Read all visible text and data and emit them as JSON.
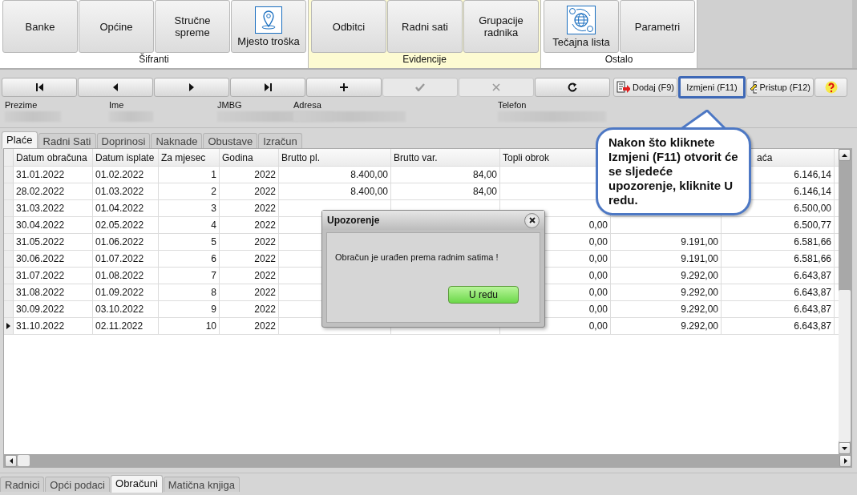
{
  "ribbon": {
    "groups": [
      {
        "label": "Šifranti",
        "highlighted": false,
        "buttons": [
          {
            "label": "Banke"
          },
          {
            "label": "Općine"
          },
          {
            "label": "Stručne spreme"
          },
          {
            "label": "Mjesto troška",
            "kind": "location"
          }
        ]
      },
      {
        "label": "Evidencije",
        "highlighted": true,
        "buttons": [
          {
            "label": "Odbitci"
          },
          {
            "label": "Radni sati"
          },
          {
            "label": "Grupacije radnika"
          }
        ]
      },
      {
        "label": "Ostalo",
        "highlighted": false,
        "buttons": [
          {
            "label": "Tečajna lista",
            "kind": "currency"
          },
          {
            "label": "Parametri"
          }
        ]
      }
    ]
  },
  "navigator": [
    {
      "kind": "first",
      "disabled": false
    },
    {
      "kind": "prev",
      "disabled": false
    },
    {
      "kind": "next",
      "disabled": false
    },
    {
      "kind": "last",
      "disabled": false
    },
    {
      "kind": "add",
      "disabled": false
    },
    {
      "kind": "confirm",
      "disabled": true
    },
    {
      "kind": "cancel",
      "disabled": true
    },
    {
      "kind": "refresh",
      "disabled": false
    }
  ],
  "actions": [
    {
      "label": "Dodaj (F9)",
      "kind": "add",
      "highlighted": false
    },
    {
      "label": "Izmjeni (F11)",
      "kind": "edit",
      "highlighted": true
    },
    {
      "label": "Pristup (F12)",
      "kind": "access",
      "highlighted": false
    },
    {
      "kind": "help",
      "highlighted": false
    }
  ],
  "fields": [
    {
      "label": "Prezime"
    },
    {
      "label": "Ime"
    },
    {
      "label": "JMBG"
    },
    {
      "label": "Adresa"
    },
    {
      "label": "Telefon"
    }
  ],
  "tabs": [
    {
      "label": "Plaće",
      "selected": true
    },
    {
      "label": "Radni Sati",
      "selected": false
    },
    {
      "label": "Doprinosi",
      "selected": false
    },
    {
      "label": "Naknade",
      "selected": false
    },
    {
      "label": "Obustave",
      "selected": false
    },
    {
      "label": "Izračun",
      "selected": false
    }
  ],
  "table": {
    "columns": [
      "Datum obračuna",
      "Datum isplate",
      "Za mjesec",
      "Godina",
      "Brutto pl.",
      "Brutto var.",
      "Topli obrok",
      null,
      "aća"
    ],
    "rows": [
      {
        "selected": false,
        "cells": [
          "31.01.2022",
          "01.02.2022",
          "1",
          "2022",
          "8.400,00",
          "84,00",
          null,
          null,
          "6.146,14"
        ]
      },
      {
        "selected": false,
        "cells": [
          "28.02.2022",
          "01.03.2022",
          "2",
          "2022",
          "8.400,00",
          "84,00",
          null,
          null,
          "6.146,14"
        ]
      },
      {
        "selected": false,
        "cells": [
          "31.03.2022",
          "01.04.2022",
          "3",
          "2022",
          null,
          null,
          null,
          null,
          "6.500,00"
        ]
      },
      {
        "selected": false,
        "cells": [
          "30.04.2022",
          "02.05.2022",
          "4",
          "2022",
          null,
          null,
          "0,00",
          null,
          "6.500,77"
        ]
      },
      {
        "selected": false,
        "cells": [
          "31.05.2022",
          "01.06.2022",
          "5",
          "2022",
          null,
          null,
          "0,00",
          "9.191,00",
          "6.581,66"
        ]
      },
      {
        "selected": false,
        "cells": [
          "30.06.2022",
          "01.07.2022",
          "6",
          "2022",
          null,
          null,
          "0,00",
          "9.191,00",
          "6.581,66"
        ]
      },
      {
        "selected": false,
        "cells": [
          "31.07.2022",
          "01.08.2022",
          "7",
          "2022",
          null,
          null,
          "0,00",
          "9.292,00",
          "6.643,87"
        ]
      },
      {
        "selected": false,
        "cells": [
          "31.08.2022",
          "01.09.2022",
          "8",
          "2022",
          null,
          null,
          "0,00",
          "9.292,00",
          "6.643,87"
        ]
      },
      {
        "selected": false,
        "cells": [
          "30.09.2022",
          "03.10.2022",
          "9",
          "2022",
          null,
          null,
          "0,00",
          "9.292,00",
          "6.643,87"
        ]
      },
      {
        "selected": true,
        "cells": [
          "31.10.2022",
          "02.11.2022",
          "10",
          "2022",
          null,
          null,
          "0,00",
          "9.292,00",
          "6.643,87"
        ]
      }
    ]
  },
  "dialog": {
    "title": "Upozorenje",
    "message": "Obračun je urađen prema radnim satima !",
    "button": "U redu"
  },
  "callout": {
    "text": "Nakon što kliknete Izmjeni (F11) otvorit će se sljedeće upozorenje, kliknite U redu."
  },
  "bottom_tabs": [
    {
      "label": "Radnici",
      "selected": false
    },
    {
      "label": "Opći podaci",
      "selected": false
    },
    {
      "label": "Obračuni",
      "selected": true
    },
    {
      "label": "Matična knjiga",
      "selected": false
    }
  ]
}
